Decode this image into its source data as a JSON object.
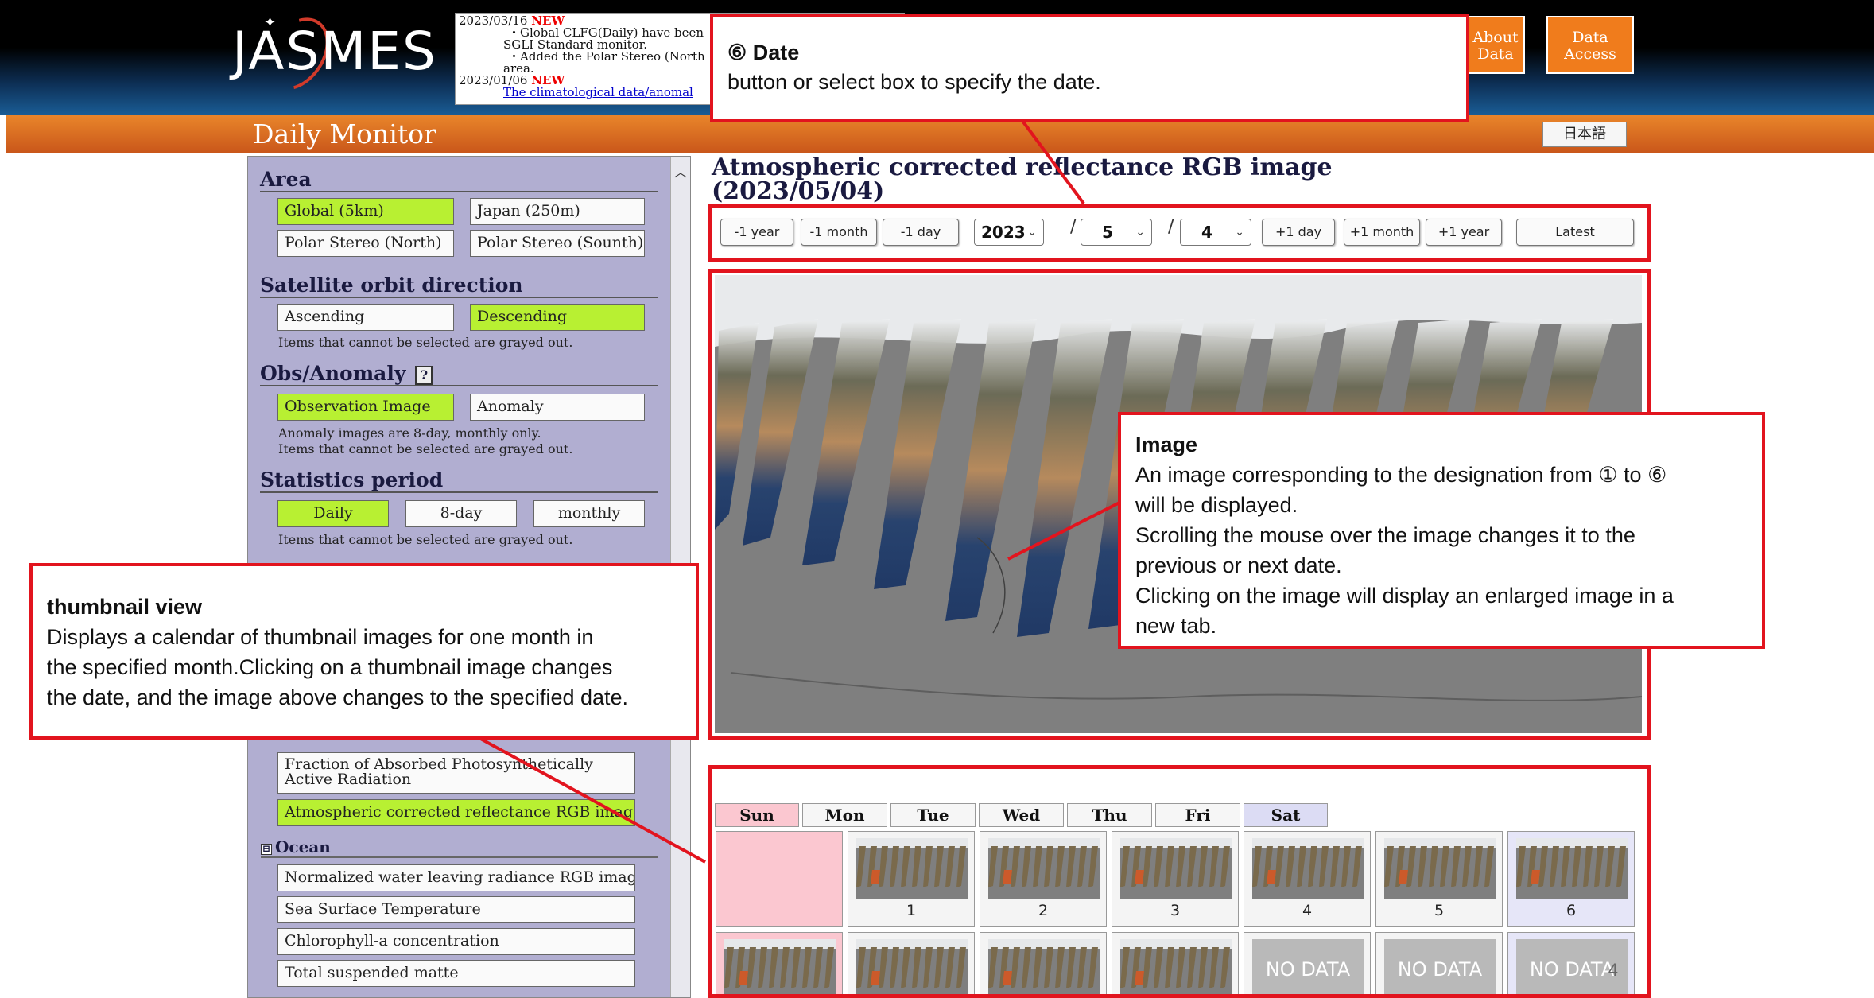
{
  "header": {
    "logo_text": "JASMES",
    "news": [
      {
        "date": "2023/03/16",
        "badge": "NEW",
        "lines": [
          "・Global CLFG(Daily) have been",
          "SGLI Standard monitor.",
          "・Added the Polar Stereo (North",
          "area."
        ]
      },
      {
        "date": "2023/01/06",
        "badge": "NEW",
        "lines": [
          "The climatological data/anomal"
        ]
      }
    ],
    "about_label": "About Data",
    "access_label": "Data Access"
  },
  "titlebar": {
    "title": "Daily Monitor",
    "lang_button": "日本語"
  },
  "sidebar": {
    "area": {
      "heading": "Area",
      "options": [
        "Global (5km)",
        "Japan (250m)",
        "Polar Stereo (North)",
        "Polar Stereo (Sounth)"
      ],
      "selected": "Global (5km)"
    },
    "orbit": {
      "heading": "Satellite orbit direction",
      "options": [
        "Ascending",
        "Descending"
      ],
      "selected": "Descending",
      "note": "Items that cannot be selected are grayed out."
    },
    "obs": {
      "heading": "Obs/Anomaly",
      "help": "?",
      "options": [
        "Observation Image",
        "Anomaly"
      ],
      "selected": "Observation Image",
      "note1": "Anomaly images are 8-day, monthly only.",
      "note2": "Items that cannot be selected are grayed out."
    },
    "period": {
      "heading": "Statistics period",
      "options": [
        "Daily",
        "8-day",
        "monthly"
      ],
      "selected": "Daily",
      "note": "Items that cannot be selected are grayed out."
    },
    "land_items": [
      "Fraction of Absorbed Photosynthetically Active Radiation",
      "Atmospheric corrected reflectance RGB image"
    ],
    "land_selected": "Atmospheric corrected reflectance RGB image",
    "ocean": {
      "heading": "Ocean",
      "toggle": "⊟",
      "items": [
        "Normalized water leaving radiance RGB image",
        "Sea Surface Temperature",
        "Chlorophyll-a concentration",
        "Total suspended matte"
      ]
    }
  },
  "main": {
    "title_line1": "Atmospheric corrected reflectance RGB image",
    "title_line2": "(2023/05/04)",
    "date_controls": {
      "minus_year": "-1 year",
      "minus_month": "-1 month",
      "minus_day": "-1 day",
      "year": "2023",
      "month": "5",
      "day": "4",
      "sep": "/",
      "plus_day": "+1 day",
      "plus_month": "+1 month",
      "plus_year": "+1 year",
      "latest": "Latest"
    }
  },
  "calendar": {
    "headers": [
      "Sun",
      "Mon",
      "Tue",
      "Wed",
      "Thu",
      "Fri",
      "Sat"
    ],
    "week1": [
      "",
      "1",
      "2",
      "3",
      "4",
      "5",
      "6"
    ],
    "no_data": "NO DATA",
    "page_number": "4"
  },
  "annotations": {
    "date": {
      "title": "⑥ Date",
      "body": "button or select box to specify the date."
    },
    "image": {
      "title": "Image",
      "body": [
        "An image corresponding to the designation from ① to ⑥",
        "will be displayed.",
        "Scrolling the mouse over the image changes it to the",
        "previous or next date.",
        "Clicking on the image will display an enlarged image in a",
        "new tab."
      ]
    },
    "thumbnail": {
      "title": "thumbnail view",
      "body": [
        "Displays a calendar of thumbnail images for one month in",
        "the specified month.Clicking on a thumbnail image changes",
        "the date, and the image above changes to the specified date."
      ]
    }
  },
  "colors": {
    "accent_red": "#e2141e",
    "selected_green": "#b8f032",
    "header_orange": "#f07c1c",
    "sidebar_purple": "#b1aed1"
  }
}
